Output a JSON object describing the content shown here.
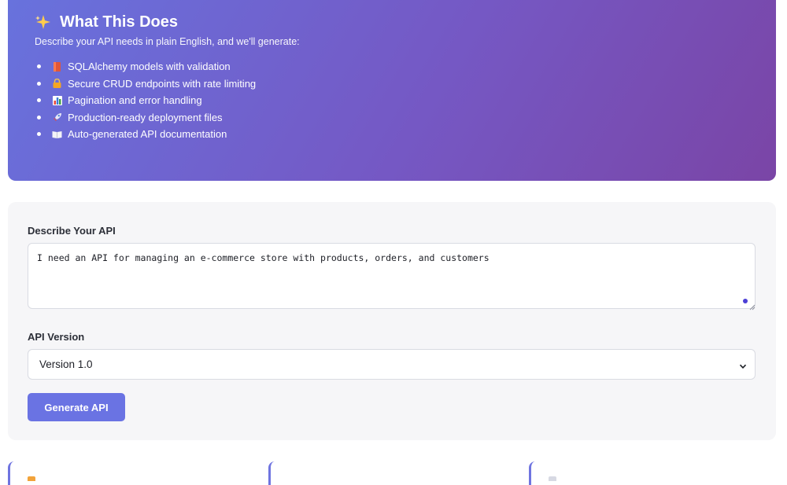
{
  "hero": {
    "title": "What This Does",
    "subtitle": "Describe your API needs in plain English, and we'll generate:",
    "features": [
      {
        "icon": "database-icon",
        "label": "SQLAlchemy models with validation"
      },
      {
        "icon": "lock-icon",
        "label": "Secure CRUD endpoints with rate limiting"
      },
      {
        "icon": "bar-chart-icon",
        "label": "Pagination and error handling"
      },
      {
        "icon": "rocket-icon",
        "label": "Production-ready deployment files"
      },
      {
        "icon": "book-icon",
        "label": "Auto-generated API documentation"
      }
    ]
  },
  "form": {
    "description_label": "Describe Your API",
    "description_value": "I need an API for managing an e-commerce store with products, orders, and customers",
    "version_label": "API Version",
    "version_selected": "Version 1.0",
    "generate_label": "Generate API"
  },
  "colors": {
    "gradient_start": "#6872dd",
    "gradient_end": "#7a45a6",
    "button": "#6a73e3",
    "card_bg": "#f6f6f8"
  }
}
